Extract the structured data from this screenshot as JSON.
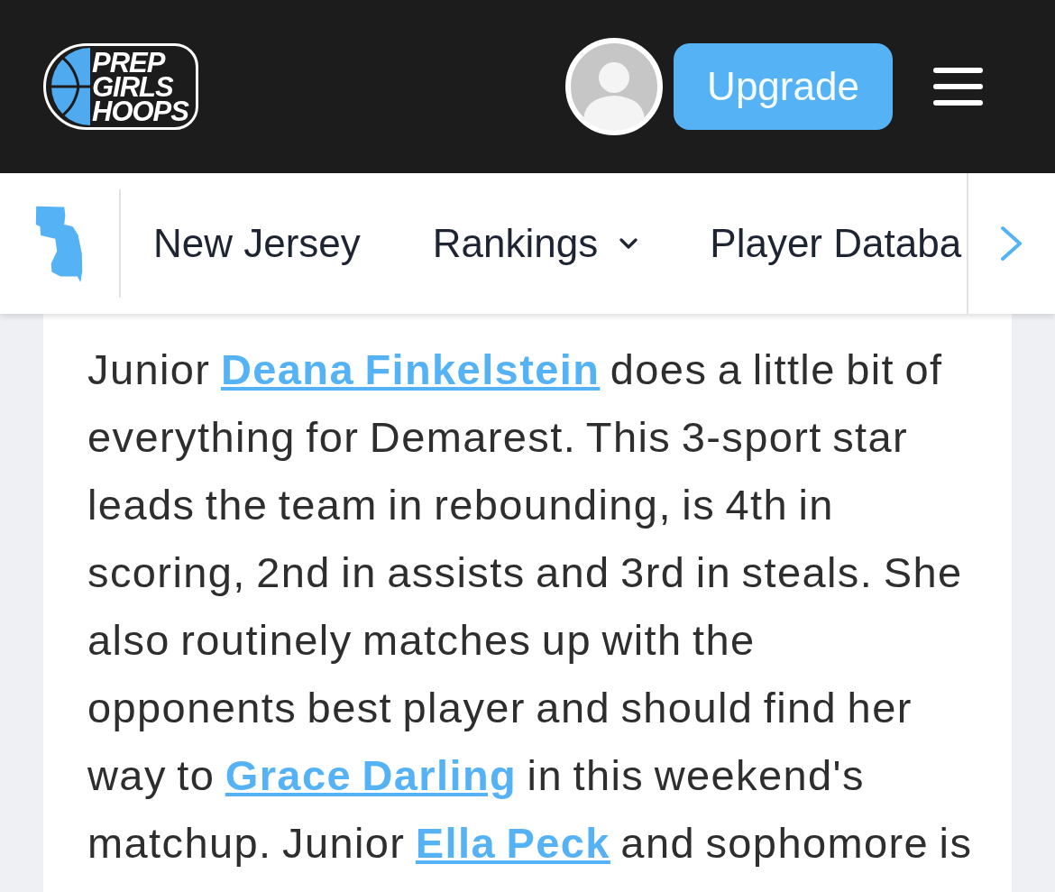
{
  "header": {
    "logo": {
      "lines": [
        "PREP",
        "GIRLS",
        "HOOPS"
      ]
    },
    "upgrade_button": "Upgrade"
  },
  "nav": {
    "items": [
      {
        "label": "New Jersey",
        "has_menu": false
      },
      {
        "label": "Rankings",
        "has_menu": true
      },
      {
        "label": "Player Databa",
        "has_menu": false
      }
    ]
  },
  "article": {
    "paragraph": [
      {
        "kind": "text",
        "text": "Junior "
      },
      {
        "kind": "link",
        "text": "Deana Finkelstein"
      },
      {
        "kind": "text",
        "text": " does a little bit of everything for Demarest. This 3-sport star leads the team in rebounding, is 4th in scoring, 2nd in assists and 3rd in steals. She also routinely matches up with the opponents best player and should find her way to "
      },
      {
        "kind": "link",
        "text": "Grace Darling"
      },
      {
        "kind": "text",
        "text": " in this weekend's matchup. Junior "
      },
      {
        "kind": "link",
        "text": "Ella Peck"
      },
      {
        "kind": "text",
        "text": " and sophomore is"
      }
    ]
  }
}
